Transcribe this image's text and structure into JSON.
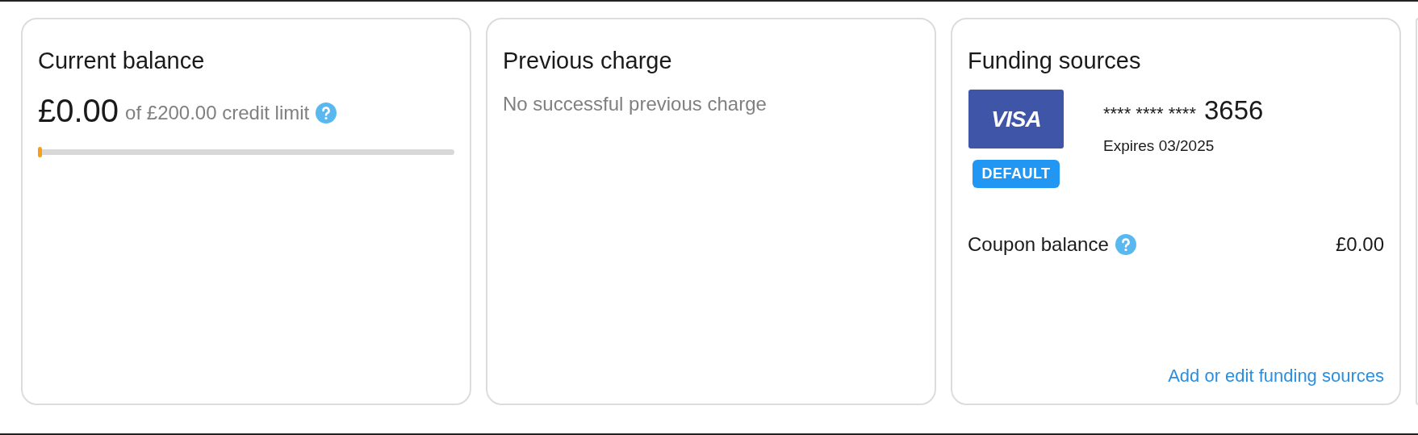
{
  "current_balance": {
    "title": "Current balance",
    "amount": "£0.00",
    "limit_text": "of £200.00 credit limit",
    "level": 0.0
  },
  "previous_charge": {
    "title": "Previous charge",
    "message": "No successful previous charge"
  },
  "funding_sources": {
    "title": "Funding sources",
    "card": {
      "logo_text": "VISA",
      "badge": "DEFAULT",
      "masked_digits": "**** **** ****",
      "last_digits": "3656",
      "expiry": "Expires 03/2025"
    },
    "coupon_label": "Coupon balance",
    "coupon_value": "£0.00",
    "link": "Add or edit funding sources"
  }
}
